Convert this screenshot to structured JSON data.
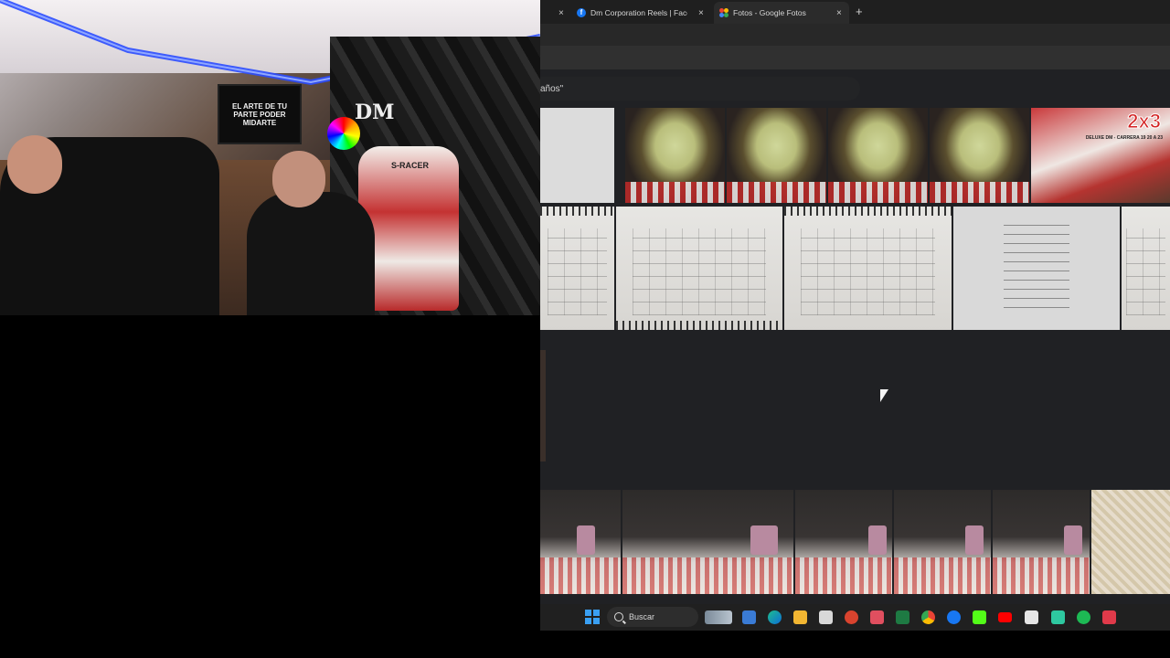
{
  "webcam": {
    "tv_text": "EL ARTE DE TU PARTE PODER MIDARTE",
    "chair_label": "S-RACER",
    "wall_logo": "DM"
  },
  "browser": {
    "tabs": [
      {
        "label": "Dm Corporation Reels | Faceb",
        "icon": "facebook-icon",
        "active": false
      },
      {
        "label": "Fotos - Google Fotos",
        "icon": "google-photos-icon",
        "active": true
      }
    ],
    "new_tab_symbol": "+",
    "close_symbol": "×",
    "search_fragment": "años\""
  },
  "photos": {
    "promo_big": "2x3",
    "promo_small": "DELUXE DM - CARRERA 19 20 A 23"
  },
  "taskbar": {
    "search_label": "Buscar",
    "apps": [
      "widgets-icon",
      "task-view-icon",
      "edge-icon",
      "file-explorer-icon",
      "store-icon",
      "office-icon",
      "mail-icon",
      "excel-icon",
      "chrome-icon",
      "facebook-icon",
      "kick-icon",
      "youtube-icon",
      "capcut-icon",
      "game-icon",
      "spotify-icon",
      "app-icon"
    ]
  },
  "colors": {
    "accent_blue": "#3aa0f3",
    "facebook_blue": "#1877f2",
    "tablecloth_red": "#c12a2a"
  }
}
